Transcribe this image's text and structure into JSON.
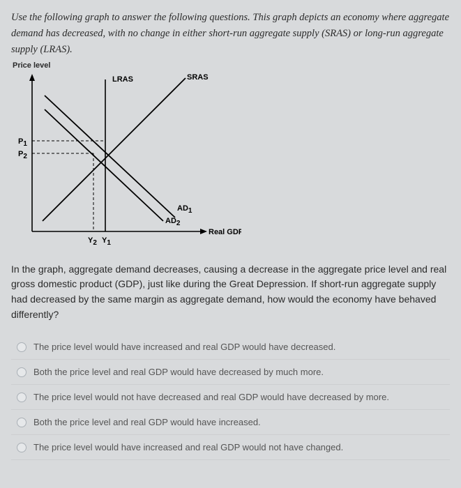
{
  "intro": "Use the following graph to answer the following questions. This graph depicts an economy where aggregate demand has decreased, with no change in either short-run aggregate supply (SRAS) or long-run aggregate supply (LRAS).",
  "chart_data": {
    "type": "line",
    "title": "",
    "xlabel": "Real GDP",
    "ylabel": "Price level",
    "curves": [
      {
        "name": "LRAS",
        "kind": "vertical",
        "x": "Y1"
      },
      {
        "name": "SRAS",
        "kind": "upward-sloping"
      },
      {
        "name": "AD1",
        "kind": "downward-sloping"
      },
      {
        "name": "AD2",
        "kind": "downward-sloping",
        "note": "shifted left of AD1"
      }
    ],
    "points": [
      {
        "label": "P1",
        "at": [
          "Y1",
          "P1"
        ],
        "desc": "SRAS ∩ AD1"
      },
      {
        "label": "P2",
        "at": [
          "Y2",
          "P2"
        ],
        "desc": "SRAS ∩ AD2"
      }
    ],
    "x_ticks": [
      "Y2",
      "Y1"
    ],
    "y_ticks": [
      "P1",
      "P2"
    ]
  },
  "labels": {
    "ylabel": "Price level",
    "xlabel": "Real GDP",
    "lras": "LRAS",
    "sras": "SRAS",
    "ad1": "AD",
    "ad1_sub": "1",
    "ad2": "AD",
    "ad2_sub": "2",
    "p1": "P",
    "p1_sub": "1",
    "p2": "P",
    "p2_sub": "2",
    "y1": "Y",
    "y1_sub": "1",
    "y2": "Y",
    "y2_sub": "2"
  },
  "explain": "In the graph, aggregate demand decreases, causing a decrease in the aggregate price level and real gross domestic product (GDP), just like during the Great Depression. If short-run aggregate supply had decreased by the same margin as aggregate demand, how would the economy have behaved differently?",
  "options": {
    "a": "The price level would have increased and real GDP would have decreased.",
    "b": "Both the price level and real GDP would have decreased by much more.",
    "c": "The price level would not have decreased and real GDP would have decreased by more.",
    "d": "Both the price level and real GDP would have increased.",
    "e": "The price level would have increased and real GDP would not have changed."
  }
}
